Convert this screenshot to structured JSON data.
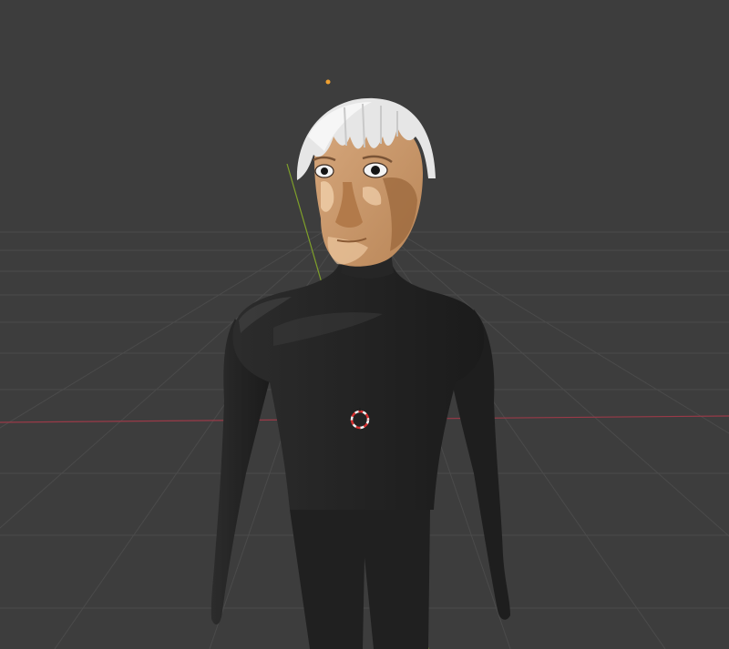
{
  "app": {
    "name": "3D viewport",
    "background_color": "#3d3d3d"
  },
  "viewport": {
    "grid_color": "#4a4a4a",
    "x_axis_color": "#9a3a48",
    "y_axis_color": "#7fa02a",
    "icons": [
      "light-icon",
      "3d-cursor-icon"
    ]
  },
  "model": {
    "suit_color": "#2a2a2a",
    "skin_color": "#d4a47a",
    "hair_color": "#e8e8e8"
  }
}
